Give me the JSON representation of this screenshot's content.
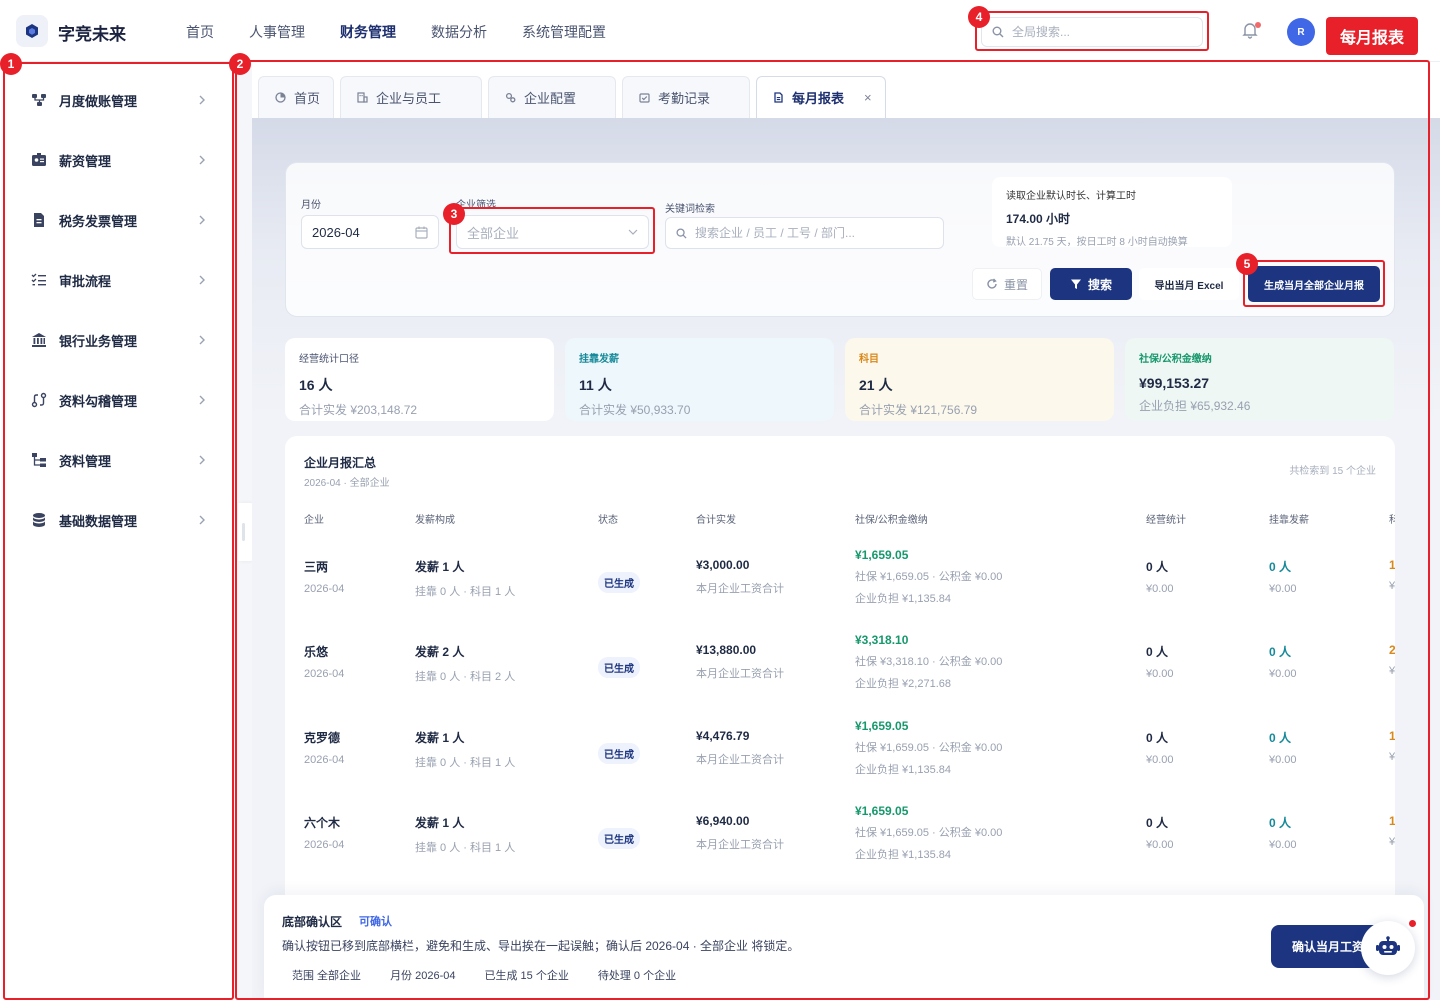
{
  "app": {
    "name": "字竞未来"
  },
  "topnav": [
    "首页",
    "人事管理",
    "财务管理",
    "数据分析",
    "系统管理配置"
  ],
  "search": {
    "placeholder": "全局搜索..."
  },
  "user": {
    "initial": "R"
  },
  "page_tag": "每月报表",
  "sidebar": {
    "items": [
      {
        "label": "月度做账管理",
        "icon": "org-chart-icon"
      },
      {
        "label": "薪资管理",
        "icon": "id-card-icon"
      },
      {
        "label": "税务发票管理",
        "icon": "file-icon"
      },
      {
        "label": "审批流程",
        "icon": "checklist-icon"
      },
      {
        "label": "银行业务管理",
        "icon": "bank-icon"
      },
      {
        "label": "资料勾稽管理",
        "icon": "route-icon"
      },
      {
        "label": "资料管理",
        "icon": "tree-icon"
      },
      {
        "label": "基础数据管理",
        "icon": "database-icon"
      }
    ]
  },
  "tabs": [
    {
      "label": "首页"
    },
    {
      "label": "企业与员工"
    },
    {
      "label": "企业配置"
    },
    {
      "label": "考勤记录"
    },
    {
      "label": "每月报表",
      "close": "×"
    }
  ],
  "filters": {
    "month_label": "月份",
    "month_value": "2026-04",
    "company_label": "企业筛选",
    "company_placeholder": "全部企业",
    "keyword_label": "关键词检索",
    "keyword_placeholder": "搜索企业 / 员工 / 工号 / 部门..."
  },
  "info": {
    "title": "读取企业默认时长、计算工时",
    "value": "174.00 小时",
    "note": "默认 21.75 天，按日工时 8 小时自动换算"
  },
  "buttons": {
    "reset": "重置",
    "search": "搜索",
    "export": "导出当月 Excel",
    "generate": "生成当月全部企业月报"
  },
  "stats": [
    {
      "title": "经营统计口径",
      "count": "16 人",
      "sub": "合计实发 ¥203,148.72",
      "color": "#4a5470",
      "bg": "#ffffff"
    },
    {
      "title": "挂靠发薪",
      "count": "11 人",
      "sub": "合计实发 ¥50,933.70",
      "color": "#168a9a",
      "bg": "#eef7fb"
    },
    {
      "title": "科目",
      "count": "21 人",
      "sub": "合计实发 ¥121,756.79",
      "color": "#d9881a",
      "bg": "#fcf8ec"
    },
    {
      "title": "社保/公积金缴纳",
      "count": "¥99,153.27",
      "sub": "企业负担 ¥65,932.46",
      "color": "#17986c",
      "bg": "#eef7f4"
    }
  ],
  "table": {
    "title": "企业月报汇总",
    "subtitle": "2026-04 · 全部企业",
    "count": "共检索到 15 个企业",
    "headers": [
      "企业",
      "发薪构成",
      "状态",
      "合计实发",
      "社保/公积金缴纳",
      "经营统计",
      "挂靠发薪",
      "科"
    ],
    "rows": [
      {
        "company": "三两",
        "month": "2026-04",
        "pay": "发薪 1 人",
        "pay_sub": "挂靠 0 人 · 科目 1 人",
        "status": "已生成",
        "total": "¥3,000.00",
        "total_sub": "本月企业工资合计",
        "ss": "¥1,659.05",
        "ss_sub1": "社保 ¥1,659.05 · 公积金 ¥0.00",
        "ss_sub2": "企业负担 ¥1,135.84",
        "op": "0 人",
        "op_sub": "¥0.00",
        "gk": "0 人",
        "gk_sub": "¥0.00",
        "km": "1",
        "km_sub": "¥"
      },
      {
        "company": "乐悠",
        "month": "2026-04",
        "pay": "发薪 2 人",
        "pay_sub": "挂靠 0 人 · 科目 2 人",
        "status": "已生成",
        "total": "¥13,880.00",
        "total_sub": "本月企业工资合计",
        "ss": "¥3,318.10",
        "ss_sub1": "社保 ¥3,318.10 · 公积金 ¥0.00",
        "ss_sub2": "企业负担 ¥2,271.68",
        "op": "0 人",
        "op_sub": "¥0.00",
        "gk": "0 人",
        "gk_sub": "¥0.00",
        "km": "2",
        "km_sub": "¥"
      },
      {
        "company": "克罗德",
        "month": "2026-04",
        "pay": "发薪 1 人",
        "pay_sub": "挂靠 0 人 · 科目 1 人",
        "status": "已生成",
        "total": "¥4,476.79",
        "total_sub": "本月企业工资合计",
        "ss": "¥1,659.05",
        "ss_sub1": "社保 ¥1,659.05 · 公积金 ¥0.00",
        "ss_sub2": "企业负担 ¥1,135.84",
        "op": "0 人",
        "op_sub": "¥0.00",
        "gk": "0 人",
        "gk_sub": "¥0.00",
        "km": "1",
        "km_sub": "¥"
      },
      {
        "company": "六个木",
        "month": "2026-04",
        "pay": "发薪 1 人",
        "pay_sub": "挂靠 0 人 · 科目 1 人",
        "status": "已生成",
        "total": "¥6,940.00",
        "total_sub": "本月企业工资合计",
        "ss": "¥1,659.05",
        "ss_sub1": "社保 ¥1,659.05 · 公积金 ¥0.00",
        "ss_sub2": "企业负担 ¥1,135.84",
        "op": "0 人",
        "op_sub": "¥0.00",
        "gk": "0 人",
        "gk_sub": "¥0.00",
        "km": "1",
        "km_sub": "¥"
      }
    ]
  },
  "bottom": {
    "title": "底部确认区",
    "tag": "可确认",
    "desc": "确认按钮已移到底部横栏，避免和生成、导出挨在一起误触；确认后 2026-04 · 全部企业 将锁定。",
    "scope": "范围 全部企业",
    "month": "月份 2026-04",
    "generated": "已生成 15 个企业",
    "pending": "待处理 0 个企业",
    "confirm": "确认当月工资"
  },
  "annotations": [
    "1",
    "2",
    "3",
    "4",
    "5"
  ],
  "colors": {
    "accent": "#1d3580",
    "highlight": "#e8202a",
    "green": "#17986c",
    "teal": "#168a9a",
    "orange": "#d9881a"
  }
}
